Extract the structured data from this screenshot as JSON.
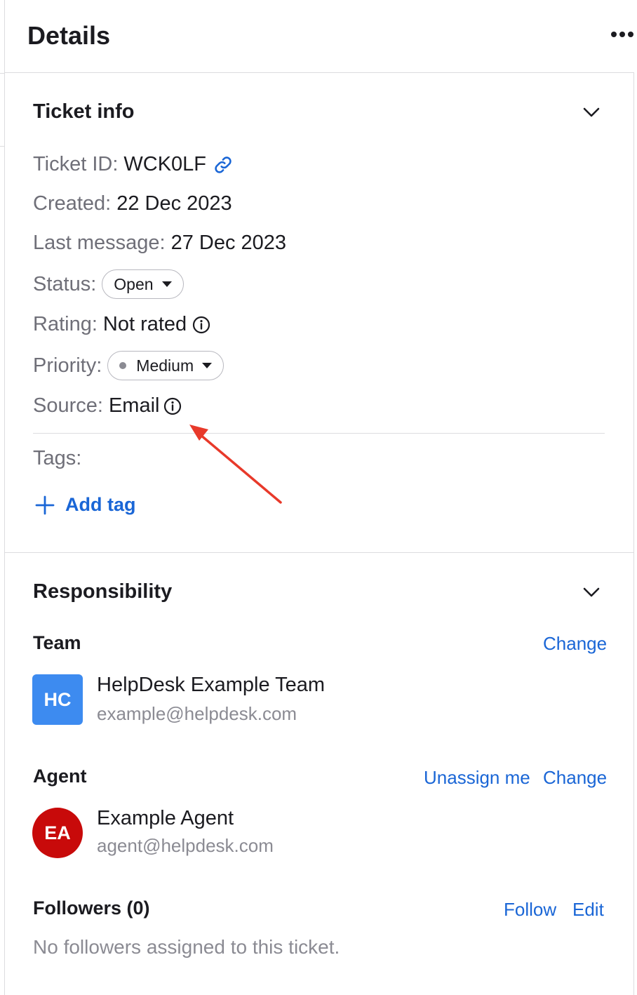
{
  "header": {
    "title": "Details"
  },
  "ticket_info": {
    "title": "Ticket info",
    "ticket_id_label": "Ticket ID:",
    "ticket_id_value": "WCK0LF",
    "created_label": "Created:",
    "created_value": "22 Dec 2023",
    "last_message_label": "Last message:",
    "last_message_value": "27 Dec 2023",
    "status_label": "Status:",
    "status_value": "Open",
    "rating_label": "Rating:",
    "rating_value": "Not rated",
    "priority_label": "Priority:",
    "priority_value": "Medium",
    "source_label": "Source:",
    "source_value": "Email",
    "tags_label": "Tags:",
    "add_tag_label": "Add tag"
  },
  "responsibility": {
    "title": "Responsibility",
    "team": {
      "label": "Team",
      "change_label": "Change",
      "avatar_initials": "HC",
      "name": "HelpDesk Example Team",
      "email": "example@helpdesk.com"
    },
    "agent": {
      "label": "Agent",
      "unassign_label": "Unassign me",
      "change_label": "Change",
      "avatar_initials": "EA",
      "name": "Example Agent",
      "email": "agent@helpdesk.com"
    },
    "followers": {
      "label": "Followers (0)",
      "follow_label": "Follow",
      "edit_label": "Edit",
      "empty_text": "No followers assigned to this ticket."
    }
  },
  "colors": {
    "link": "#1a66d6",
    "team_avatar": "#3d8bf0",
    "agent_avatar": "#c80a0a",
    "annotation_arrow": "#e8392a"
  },
  "icons": {
    "more": "more-horizontal-icon",
    "collapse": "chevron-down-icon",
    "copy_link": "link-icon",
    "info": "info-icon",
    "add": "plus-icon"
  }
}
